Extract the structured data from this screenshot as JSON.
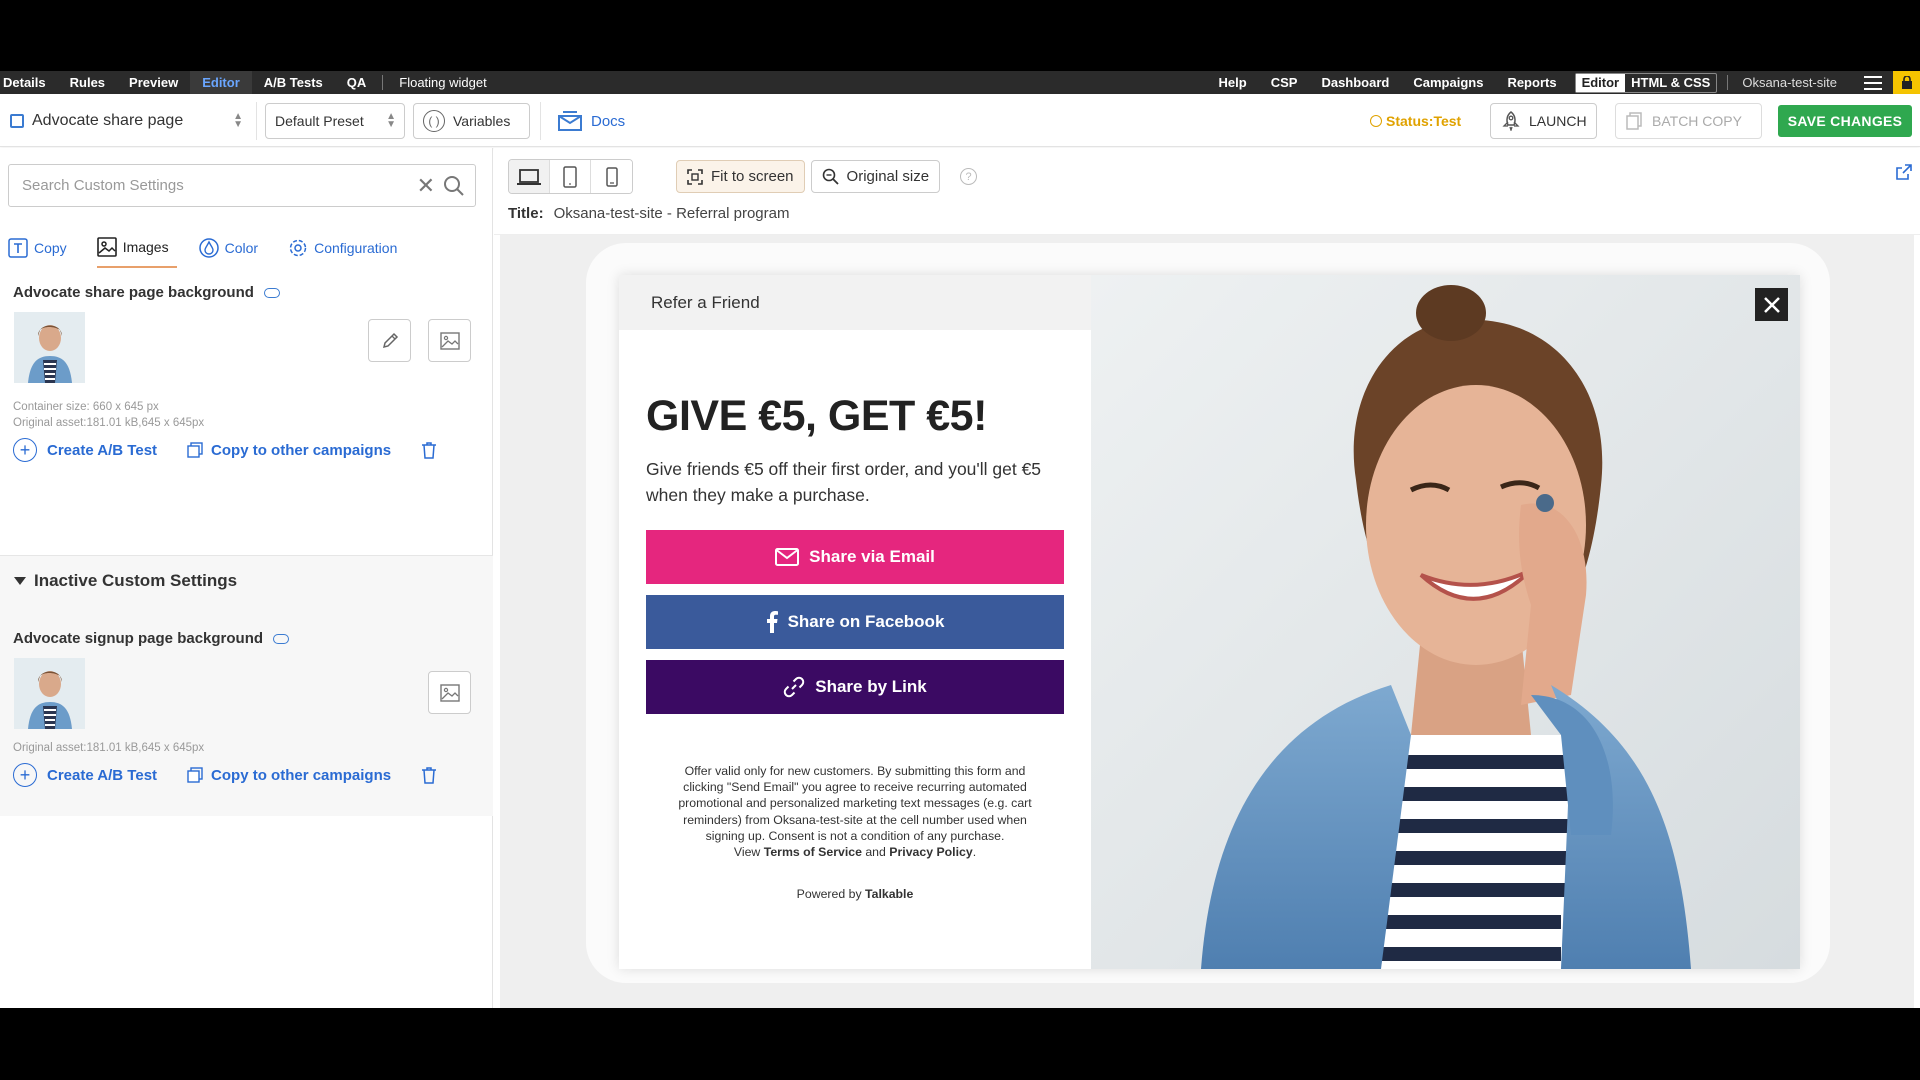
{
  "nav": {
    "left": [
      "Details",
      "Rules",
      "Preview",
      "Editor",
      "A/B Tests",
      "QA"
    ],
    "active": "Editor",
    "context": "Floating widget",
    "right": [
      "Help",
      "CSP",
      "Dashboard",
      "Campaigns",
      "Reports"
    ],
    "mode_segments": [
      "Editor",
      "HTML & CSS"
    ],
    "site": "Oksana-test-site"
  },
  "toolbar": {
    "page": "Advocate share page",
    "preset": "Default Preset",
    "variables": "Variables",
    "docs": "Docs",
    "status": "Status:Test",
    "launch": "LAUNCH",
    "batch_copy": "BATCH COPY",
    "save": "SAVE CHANGES"
  },
  "sidebar": {
    "search_placeholder": "Search Custom Settings",
    "tabs": [
      "Copy",
      "Images",
      "Color",
      "Configuration"
    ],
    "active_tab": "Images",
    "active_setting": {
      "title": "Advocate share page background",
      "container_size": "Container size: 660 x 645 px",
      "original_asset": "Original asset:181.01 kB,645 x 645px",
      "create_ab": "Create A/B Test",
      "copy_campaigns": "Copy to other campaigns"
    },
    "inactive_header": "Inactive Custom Settings",
    "inactive_setting": {
      "title": "Advocate signup page background",
      "original_asset": "Original asset:181.01 kB,645 x 645px",
      "create_ab": "Create A/B Test",
      "copy_campaigns": "Copy to other campaigns"
    }
  },
  "canvas": {
    "fit": "Fit to screen",
    "original": "Original size",
    "title_label": "Title:",
    "title_value": "Oksana-test-site - Referral program"
  },
  "widget": {
    "header": "Refer a Friend",
    "headline": "GIVE €5, GET €5!",
    "subtext": "Give friends €5 off their first order, and you'll get €5 when they make a purchase.",
    "buttons": [
      {
        "label": "Share via Email",
        "color": "#e5267e"
      },
      {
        "label": "Share on Facebook",
        "color": "#3a5a9b"
      },
      {
        "label": "Share by Link",
        "color": "#3b0a63"
      }
    ],
    "legal": "Offer valid only for new customers. By submitting this form and clicking \"Send Email\" you agree to receive recurring automated promotional and personalized marketing text messages (e.g. cart reminders) from Oksana-test-site at the cell number used when signing up. Consent is not a condition of any purchase.",
    "view_prefix": "View",
    "terms": "Terms of Service",
    "and": "and",
    "privacy": "Privacy Policy",
    "period": ".",
    "powered_prefix": "Powered by",
    "powered_brand": "Talkable"
  },
  "colors": {
    "accent_blue": "#2a6bd3",
    "save_green": "#2fa84f",
    "status_amber": "#e0a200"
  }
}
